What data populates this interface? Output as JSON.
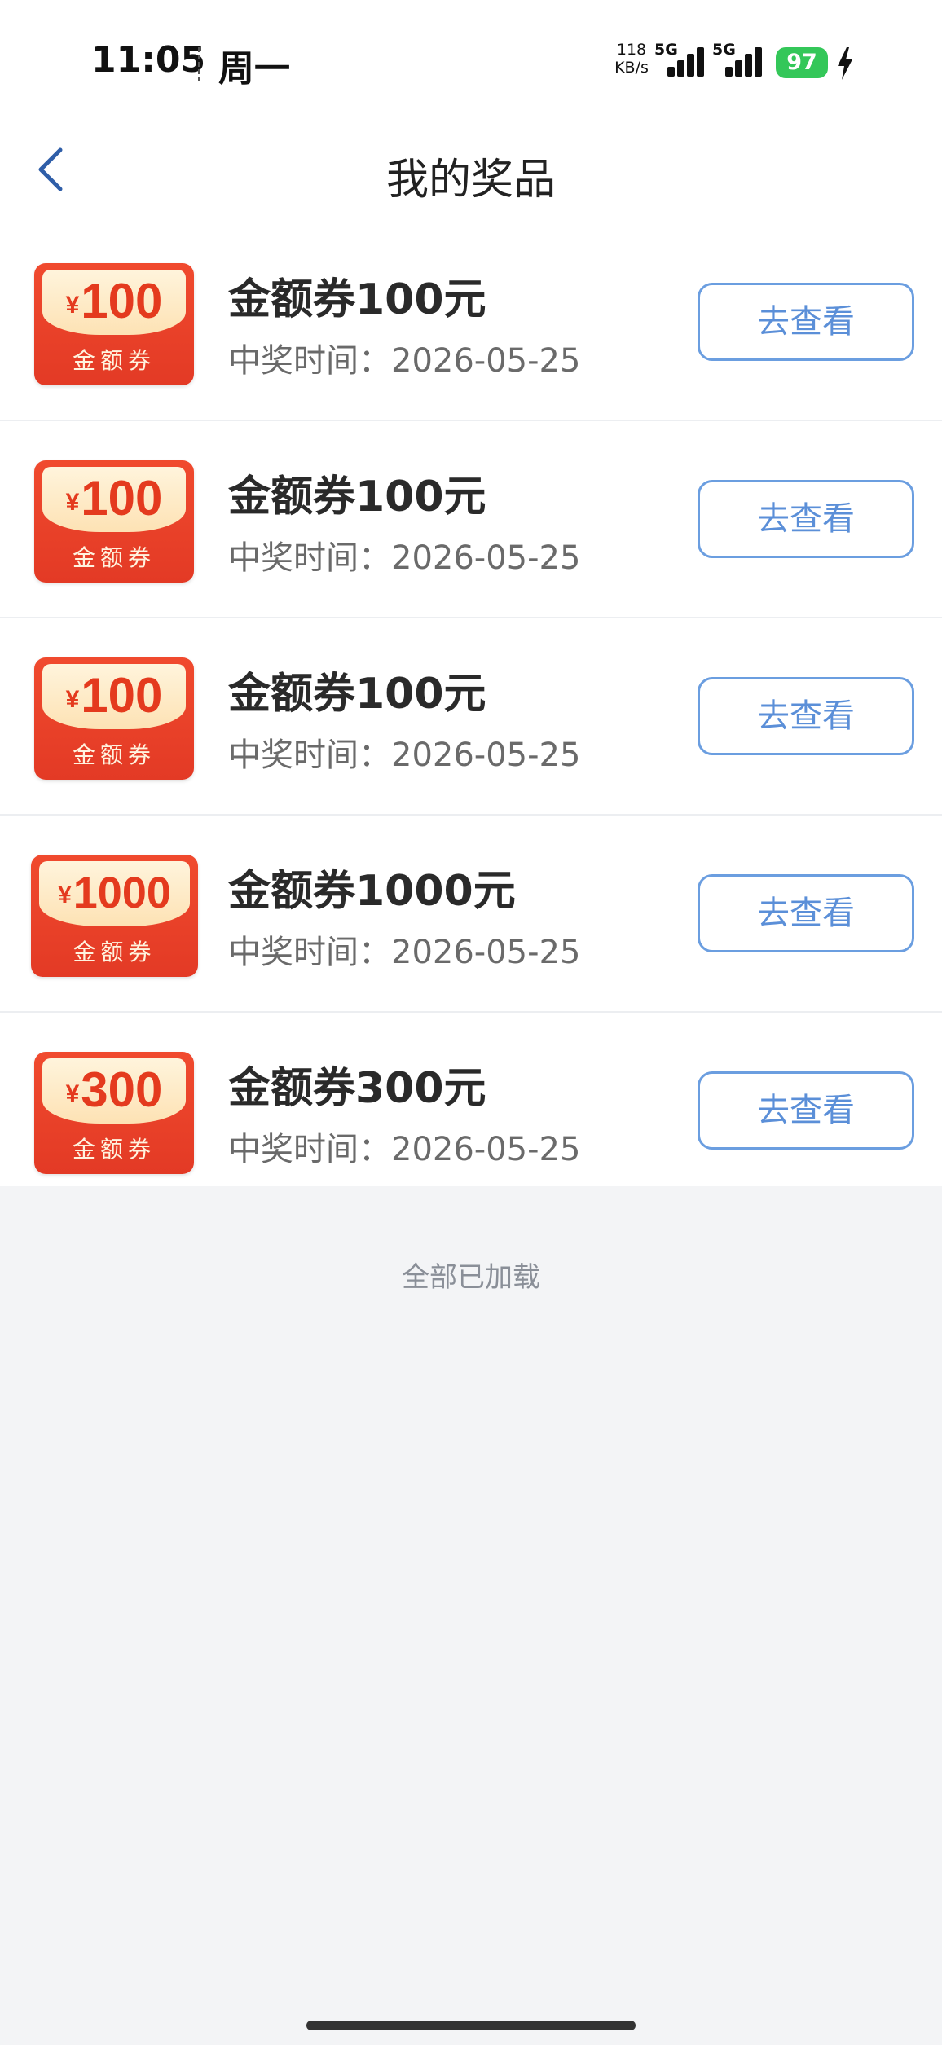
{
  "status_bar": {
    "time": "11:05",
    "day": "周一",
    "net_speed_value": "118",
    "net_speed_unit": "KB/s",
    "signal1_label": "5G",
    "signal2_label": "5G",
    "battery": "97"
  },
  "header": {
    "title": "我的奖品"
  },
  "prizes": [
    {
      "coupon_symbol": "¥",
      "coupon_amount": "100",
      "coupon_label": "金额券",
      "title": "金额券100元",
      "time": "中奖时间：2026-05-25",
      "button": "去查看"
    },
    {
      "coupon_symbol": "¥",
      "coupon_amount": "100",
      "coupon_label": "金额券",
      "title": "金额券100元",
      "time": "中奖时间：2026-05-25",
      "button": "去查看"
    },
    {
      "coupon_symbol": "¥",
      "coupon_amount": "100",
      "coupon_label": "金额券",
      "title": "金额券100元",
      "time": "中奖时间：2026-05-25",
      "button": "去查看"
    },
    {
      "coupon_symbol": "¥",
      "coupon_amount": "1000",
      "coupon_label": "金额券",
      "title": "金额券1000元",
      "time": "中奖时间：2026-05-25",
      "button": "去查看"
    },
    {
      "coupon_symbol": "¥",
      "coupon_amount": "300",
      "coupon_label": "金额券",
      "title": "金额券300元",
      "time": "中奖时间：2026-05-25",
      "button": "去查看"
    }
  ],
  "footer": {
    "all_loaded": "全部已加载"
  },
  "colors": {
    "accent": "#5b8fd8",
    "coupon_red": "#e33a25",
    "battery_green": "#34c759",
    "page_bg": "#f3f4f6"
  }
}
